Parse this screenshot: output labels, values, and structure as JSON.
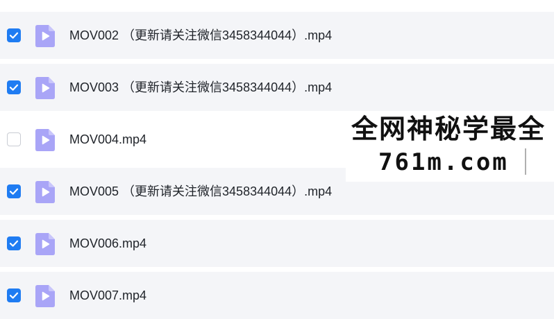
{
  "files": [
    {
      "name": "MOV002 （更新请关注微信3458344044）.mp4",
      "checked": true
    },
    {
      "name": "MOV003 （更新请关注微信3458344044）.mp4",
      "checked": true
    },
    {
      "name": "MOV004.mp4",
      "checked": false
    },
    {
      "name": "MOV005 （更新请关注微信3458344044）.mp4",
      "checked": true
    },
    {
      "name": "MOV006.mp4",
      "checked": true
    },
    {
      "name": "MOV007.mp4",
      "checked": true
    }
  ],
  "watermark": {
    "line1": "全网神秘学最全",
    "line2": "761m.com"
  },
  "colors": {
    "checkbox_checked": "#1f7cf2",
    "file_icon": "#a9a5f7",
    "selected_row_bg": "#f4f5f8"
  },
  "icons": {
    "checkbox": "check-icon",
    "file": "video-file-icon"
  }
}
